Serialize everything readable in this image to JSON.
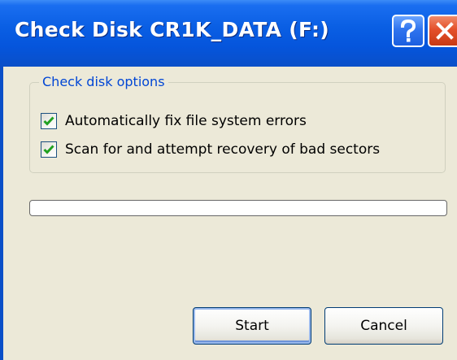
{
  "window": {
    "title": "Check Disk CR1K_DATA (F:)",
    "help_button": "?",
    "close_button": "close",
    "title_bar_color": "#0555dc",
    "background_color": "#ece9d8"
  },
  "options": {
    "group_label": "Check disk options",
    "items": [
      {
        "label": "Automatically fix file system errors",
        "checked": true
      },
      {
        "label": "Scan for and attempt recovery of bad sectors",
        "checked": true
      }
    ]
  },
  "progress": {
    "fraction": 0
  },
  "buttons": {
    "start_label": "Start",
    "cancel_label": "Cancel"
  },
  "icons": {
    "help": "help-icon",
    "close": "close-icon",
    "check": "checkmark-icon"
  }
}
